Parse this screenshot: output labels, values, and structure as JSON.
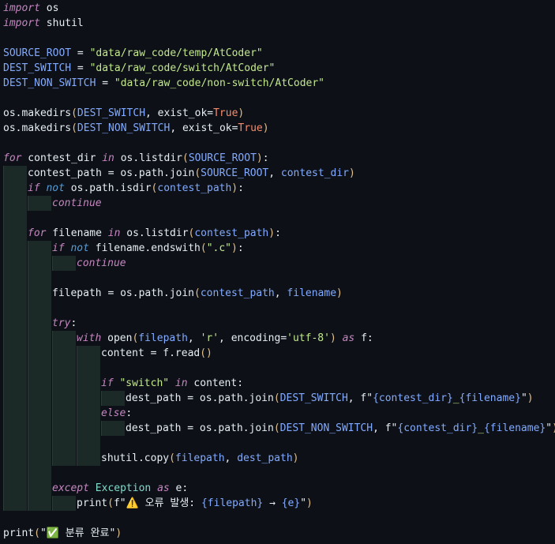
{
  "editor": {
    "language": "python",
    "lines": [
      {
        "indent": 0,
        "tokens": [
          {
            "t": "import",
            "c": "ctl"
          },
          {
            "t": " os",
            "c": "fn"
          }
        ]
      },
      {
        "indent": 0,
        "tokens": [
          {
            "t": "import",
            "c": "ctl"
          },
          {
            "t": " shutil",
            "c": "fn"
          }
        ]
      },
      {
        "indent": 0,
        "tokens": []
      },
      {
        "indent": 0,
        "tokens": [
          {
            "t": "SOURCE_ROOT",
            "c": "var"
          },
          {
            "t": " = ",
            "c": "punc"
          },
          {
            "t": "\"data/raw_code/temp/AtCoder\"",
            "c": "str"
          }
        ]
      },
      {
        "indent": 0,
        "tokens": [
          {
            "t": "DEST_SWITCH",
            "c": "var"
          },
          {
            "t": " = ",
            "c": "punc"
          },
          {
            "t": "\"data/raw_code/switch/AtCoder\"",
            "c": "str"
          }
        ]
      },
      {
        "indent": 0,
        "tokens": [
          {
            "t": "DEST_NON_SWITCH",
            "c": "var"
          },
          {
            "t": " = ",
            "c": "punc"
          },
          {
            "t": "\"data/raw_code/non-switch/AtCoder\"",
            "c": "str"
          }
        ]
      },
      {
        "indent": 0,
        "tokens": []
      },
      {
        "indent": 0,
        "tokens": [
          {
            "t": "os.makedirs",
            "c": "fn"
          },
          {
            "t": "(",
            "c": "paren"
          },
          {
            "t": "DEST_SWITCH",
            "c": "var"
          },
          {
            "t": ", exist_ok=",
            "c": "punc"
          },
          {
            "t": "True",
            "c": "bool"
          },
          {
            "t": ")",
            "c": "paren"
          }
        ]
      },
      {
        "indent": 0,
        "tokens": [
          {
            "t": "os.makedirs",
            "c": "fn"
          },
          {
            "t": "(",
            "c": "paren"
          },
          {
            "t": "DEST_NON_SWITCH",
            "c": "var"
          },
          {
            "t": ", exist_ok=",
            "c": "punc"
          },
          {
            "t": "True",
            "c": "bool"
          },
          {
            "t": ")",
            "c": "paren"
          }
        ]
      },
      {
        "indent": 0,
        "tokens": []
      },
      {
        "indent": 0,
        "tokens": [
          {
            "t": "for",
            "c": "ctl"
          },
          {
            "t": " contest_dir ",
            "c": "fn"
          },
          {
            "t": "in",
            "c": "ctl"
          },
          {
            "t": " os.listdir",
            "c": "fn"
          },
          {
            "t": "(",
            "c": "paren"
          },
          {
            "t": "SOURCE_ROOT",
            "c": "var"
          },
          {
            "t": ")",
            "c": "paren"
          },
          {
            "t": ":",
            "c": "punc"
          }
        ]
      },
      {
        "indent": 1,
        "tokens": [
          {
            "t": "contest_path = os.path.join",
            "c": "fn"
          },
          {
            "t": "(",
            "c": "paren"
          },
          {
            "t": "SOURCE_ROOT",
            "c": "var"
          },
          {
            "t": ", ",
            "c": "punc"
          },
          {
            "t": "contest_dir",
            "c": "var"
          },
          {
            "t": ")",
            "c": "paren"
          }
        ]
      },
      {
        "indent": 1,
        "tokens": [
          {
            "t": "if",
            "c": "ctl"
          },
          {
            "t": " not",
            "c": "kw"
          },
          {
            "t": " os.path.isdir",
            "c": "fn"
          },
          {
            "t": "(",
            "c": "paren"
          },
          {
            "t": "contest_path",
            "c": "var"
          },
          {
            "t": ")",
            "c": "paren"
          },
          {
            "t": ":",
            "c": "punc"
          }
        ]
      },
      {
        "indent": 2,
        "tokens": [
          {
            "t": "continue",
            "c": "ctl"
          }
        ]
      },
      {
        "indent": 1,
        "tokens": []
      },
      {
        "indent": 1,
        "tokens": [
          {
            "t": "for",
            "c": "ctl"
          },
          {
            "t": " filename ",
            "c": "fn"
          },
          {
            "t": "in",
            "c": "ctl"
          },
          {
            "t": " os.listdir",
            "c": "fn"
          },
          {
            "t": "(",
            "c": "paren"
          },
          {
            "t": "contest_path",
            "c": "var"
          },
          {
            "t": ")",
            "c": "paren"
          },
          {
            "t": ":",
            "c": "punc"
          }
        ]
      },
      {
        "indent": 2,
        "tokens": [
          {
            "t": "if",
            "c": "ctl"
          },
          {
            "t": " not",
            "c": "kw"
          },
          {
            "t": " filename.endswith",
            "c": "fn"
          },
          {
            "t": "(",
            "c": "paren"
          },
          {
            "t": "\".c\"",
            "c": "str"
          },
          {
            "t": ")",
            "c": "paren"
          },
          {
            "t": ":",
            "c": "punc"
          }
        ]
      },
      {
        "indent": 3,
        "tokens": [
          {
            "t": "continue",
            "c": "ctl"
          }
        ]
      },
      {
        "indent": 2,
        "tokens": []
      },
      {
        "indent": 2,
        "tokens": [
          {
            "t": "filepath = os.path.join",
            "c": "fn"
          },
          {
            "t": "(",
            "c": "paren"
          },
          {
            "t": "contest_path",
            "c": "var"
          },
          {
            "t": ", ",
            "c": "punc"
          },
          {
            "t": "filename",
            "c": "var"
          },
          {
            "t": ")",
            "c": "paren"
          }
        ]
      },
      {
        "indent": 2,
        "tokens": []
      },
      {
        "indent": 2,
        "tokens": [
          {
            "t": "try",
            "c": "ctl"
          },
          {
            "t": ":",
            "c": "punc"
          }
        ]
      },
      {
        "indent": 3,
        "tokens": [
          {
            "t": "with",
            "c": "ctl"
          },
          {
            "t": " open",
            "c": "fn"
          },
          {
            "t": "(",
            "c": "paren"
          },
          {
            "t": "filepath",
            "c": "var"
          },
          {
            "t": ", ",
            "c": "punc"
          },
          {
            "t": "'r'",
            "c": "str"
          },
          {
            "t": ", encoding=",
            "c": "punc"
          },
          {
            "t": "'utf-8'",
            "c": "str"
          },
          {
            "t": ")",
            "c": "paren"
          },
          {
            "t": " as",
            "c": "ctl"
          },
          {
            "t": " f:",
            "c": "fn"
          }
        ]
      },
      {
        "indent": 4,
        "tokens": [
          {
            "t": "content = f.read",
            "c": "fn"
          },
          {
            "t": "()",
            "c": "paren"
          }
        ]
      },
      {
        "indent": 4,
        "tokens": []
      },
      {
        "indent": 4,
        "tokens": [
          {
            "t": "if",
            "c": "ctl"
          },
          {
            "t": " ",
            "c": "fn"
          },
          {
            "t": "\"switch\"",
            "c": "str"
          },
          {
            "t": " in",
            "c": "ctl"
          },
          {
            "t": " content:",
            "c": "fn"
          }
        ]
      },
      {
        "indent": 5,
        "tokens": [
          {
            "t": "dest_path = os.path.join",
            "c": "fn"
          },
          {
            "t": "(",
            "c": "paren"
          },
          {
            "t": "DEST_SWITCH",
            "c": "var"
          },
          {
            "t": ", f\"",
            "c": "punc"
          },
          {
            "t": "{contest_dir}",
            "c": "var"
          },
          {
            "t": "_",
            "c": "str"
          },
          {
            "t": "{filename}",
            "c": "var"
          },
          {
            "t": "\"",
            "c": "punc"
          },
          {
            "t": ")",
            "c": "paren"
          }
        ]
      },
      {
        "indent": 4,
        "tokens": [
          {
            "t": "else",
            "c": "ctl"
          },
          {
            "t": ":",
            "c": "punc"
          }
        ]
      },
      {
        "indent": 5,
        "tokens": [
          {
            "t": "dest_path = os.path.join",
            "c": "fn"
          },
          {
            "t": "(",
            "c": "paren"
          },
          {
            "t": "DEST_NON_SWITCH",
            "c": "var"
          },
          {
            "t": ", f\"",
            "c": "punc"
          },
          {
            "t": "{contest_dir}",
            "c": "var"
          },
          {
            "t": "_",
            "c": "str"
          },
          {
            "t": "{filename}",
            "c": "var"
          },
          {
            "t": "\"",
            "c": "punc"
          },
          {
            "t": ")",
            "c": "paren"
          }
        ]
      },
      {
        "indent": 4,
        "tokens": []
      },
      {
        "indent": 4,
        "tokens": [
          {
            "t": "shutil.copy",
            "c": "fn"
          },
          {
            "t": "(",
            "c": "paren"
          },
          {
            "t": "filepath",
            "c": "var"
          },
          {
            "t": ", ",
            "c": "punc"
          },
          {
            "t": "dest_path",
            "c": "var"
          },
          {
            "t": ")",
            "c": "paren"
          }
        ]
      },
      {
        "indent": 2,
        "tokens": []
      },
      {
        "indent": 2,
        "tokens": [
          {
            "t": "except",
            "c": "ctl"
          },
          {
            "t": " Exception",
            "c": "const"
          },
          {
            "t": " as",
            "c": "ctl"
          },
          {
            "t": " e:",
            "c": "fn"
          }
        ]
      },
      {
        "indent": 3,
        "tokens": [
          {
            "t": "print",
            "c": "fn"
          },
          {
            "t": "(",
            "c": "paren"
          },
          {
            "t": "f\"",
            "c": "punc"
          },
          {
            "t": "⚠️",
            "c": "emoji"
          },
          {
            "t": " 오류 발생: ",
            "c": "fn"
          },
          {
            "t": "{filepath}",
            "c": "var"
          },
          {
            "t": " → ",
            "c": "fn"
          },
          {
            "t": "{e}",
            "c": "var"
          },
          {
            "t": "\"",
            "c": "punc"
          },
          {
            "t": ")",
            "c": "paren"
          }
        ]
      },
      {
        "indent": 0,
        "tokens": []
      },
      {
        "indent": 0,
        "tokens": [
          {
            "t": "print",
            "c": "fn"
          },
          {
            "t": "(",
            "c": "paren"
          },
          {
            "t": "\"",
            "c": "punc"
          },
          {
            "t": "✅",
            "c": "emoji"
          },
          {
            "t": " 분류 완료",
            "c": "fn"
          },
          {
            "t": "\"",
            "c": "punc"
          },
          {
            "t": ")",
            "c": "paren"
          }
        ]
      }
    ]
  }
}
